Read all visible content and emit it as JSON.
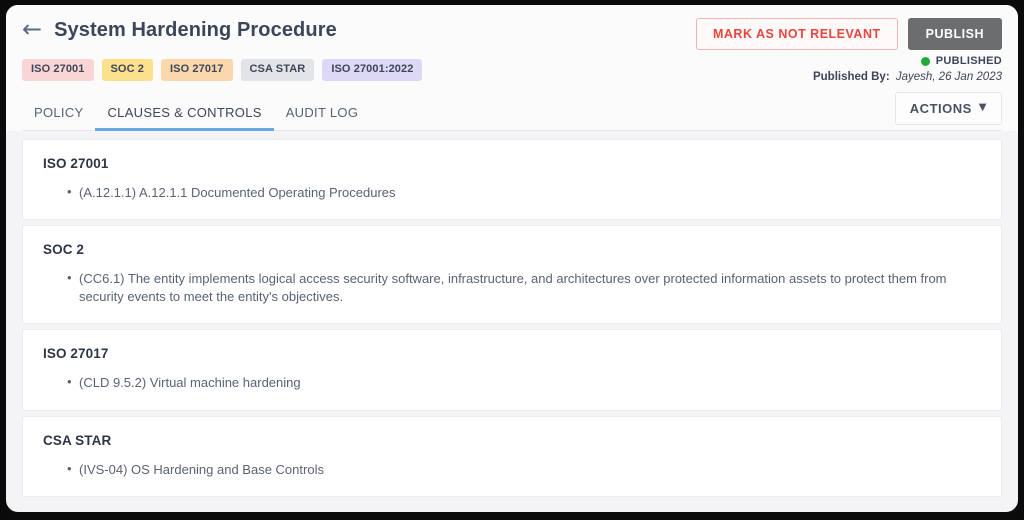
{
  "header": {
    "back_icon": "arrow-left-icon",
    "title": "System Hardening Procedure",
    "mark_not_relevant_label": "MARK AS NOT RELEVANT",
    "publish_label": "PUBLISH",
    "tags": [
      {
        "label": "ISO 27001",
        "bg": "#f9d5d5"
      },
      {
        "label": "SOC 2",
        "bg": "#fde08b"
      },
      {
        "label": "ISO 27017",
        "bg": "#fbd7ac"
      },
      {
        "label": "CSA STAR",
        "bg": "#e3e4e7"
      },
      {
        "label": "ISO 27001:2022",
        "bg": "#ded8f7"
      }
    ],
    "status": {
      "label": "PUBLISHED",
      "dot_color": "#22a838",
      "published_by_label": "Published By:",
      "published_by_value": "Jayesh, 26 Jan 2023"
    }
  },
  "tabs": [
    {
      "label": "POLICY",
      "active": false
    },
    {
      "label": "CLAUSES & CONTROLS",
      "active": true
    },
    {
      "label": "AUDIT LOG",
      "active": false
    }
  ],
  "actions": {
    "label": "ACTIONS",
    "caret": "▼"
  },
  "cards": [
    {
      "title": "ISO 27001",
      "items": [
        "(A.12.1.1) A.12.1.1 Documented Operating Procedures"
      ]
    },
    {
      "title": "SOC 2",
      "items": [
        "(CC6.1) The entity implements logical access security software, infrastructure, and architectures over protected information assets to protect them from security events to meet the entity's objectives."
      ]
    },
    {
      "title": "ISO 27017",
      "items": [
        "(CLD 9.5.2) Virtual machine hardening"
      ]
    },
    {
      "title": "CSA STAR",
      "items": [
        "(IVS-04) OS Hardening and Base Controls"
      ]
    }
  ],
  "theme": {
    "accent_blue": "#6aa9e0",
    "publish_gray": "#6c6d6f",
    "danger_red": "#e8453c",
    "page_bg": "#f4f4f6",
    "header_bg": "#fbfbfc"
  }
}
